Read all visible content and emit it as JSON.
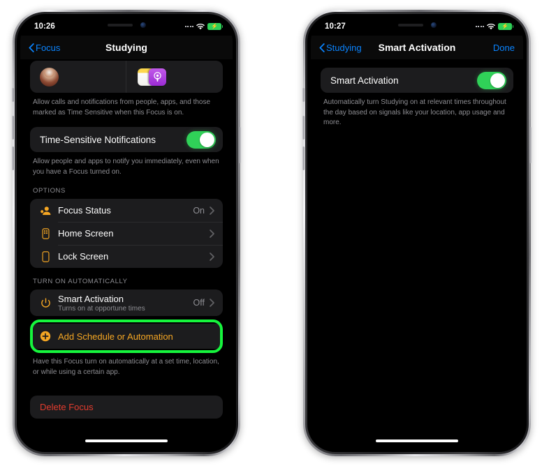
{
  "colors": {
    "accent_blue": "#0a84ff",
    "accent_orange": "#f5a623",
    "toggle_green": "#30d158",
    "highlight_green": "#16f53d",
    "destructive_red": "#e23c2e",
    "card_bg": "#1c1c1e",
    "screen_bg": "#000000",
    "secondary_text": "#8e8e93"
  },
  "phone_left": {
    "status_bar": {
      "time": "10:26",
      "signal_icon": "cellular-signal-icon",
      "wifi_icon": "wifi-icon",
      "battery_icon": "battery-charging-icon"
    },
    "nav": {
      "back_label": "Focus",
      "back_icon": "chevron-left-icon",
      "title": "Studying"
    },
    "people_apps_card": {
      "person_avatar_name": "contact-avatar",
      "app_icons": [
        "notes-app-icon",
        "podcasts-app-icon"
      ]
    },
    "allow_footnote": "Allow calls and notifications from people, apps, and those marked as Time Sensitive when this Focus is on.",
    "time_sensitive": {
      "label": "Time-Sensitive Notifications",
      "toggle_state": "on",
      "footnote": "Allow people and apps to notify you immediately, even when you have a Focus turned on."
    },
    "options_header": "OPTIONS",
    "options_rows": [
      {
        "label": "Focus Status",
        "value": "On",
        "icon": "focus-status-person-icon"
      },
      {
        "label": "Home Screen",
        "value": "",
        "icon": "home-screen-icon"
      },
      {
        "label": "Lock Screen",
        "value": "",
        "icon": "lock-screen-icon"
      }
    ],
    "turn_on_header": "TURN ON AUTOMATICALLY",
    "smart_activation_row": {
      "label": "Smart Activation",
      "subtitle": "Turns on at opportune times",
      "value": "Off",
      "icon": "power-icon"
    },
    "add_schedule_row": {
      "label": "Add Schedule or Automation",
      "icon": "plus-circle-icon",
      "highlighted": true
    },
    "add_schedule_footnote": "Have this Focus turn on automatically at a set time, location, or while using a certain app.",
    "delete_focus_label": "Delete Focus"
  },
  "phone_right": {
    "status_bar": {
      "time": "10:27",
      "signal_icon": "cellular-signal-icon",
      "wifi_icon": "wifi-icon",
      "battery_icon": "battery-charging-icon"
    },
    "nav": {
      "back_label": "Studying",
      "back_icon": "chevron-left-icon",
      "title": "Smart Activation",
      "done_label": "Done"
    },
    "smart_activation": {
      "label": "Smart Activation",
      "toggle_state": "on",
      "footnote": "Automatically turn Studying on at relevant times throughout the day based on signals like your location, app usage and more."
    }
  }
}
